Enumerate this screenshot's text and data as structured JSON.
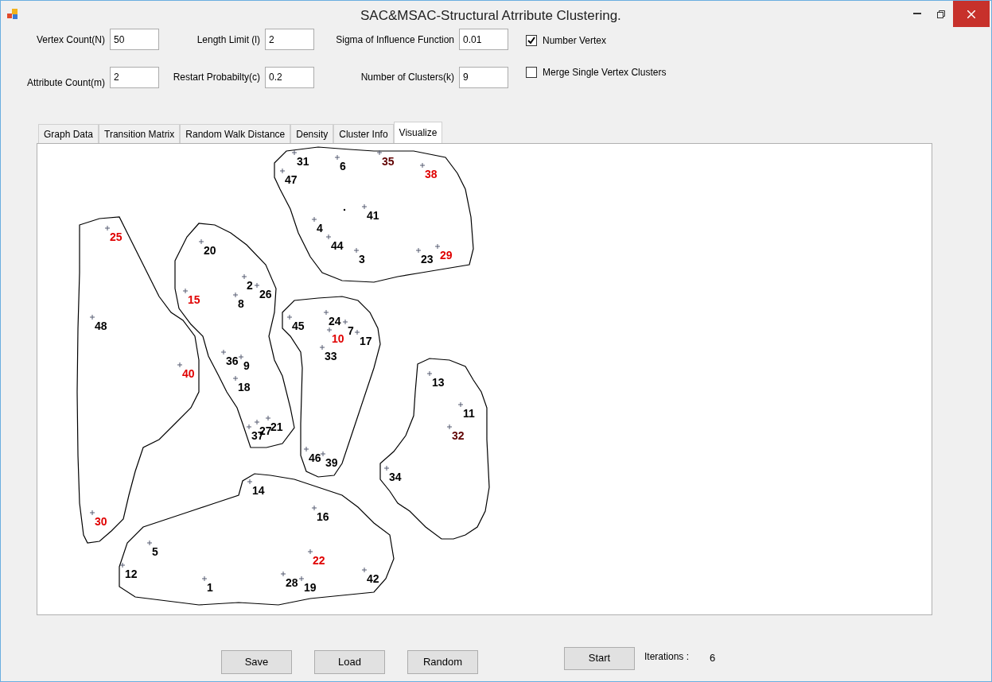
{
  "window": {
    "title": "SAC&MSAC-Structural Atrribute Clustering."
  },
  "field_rows": [
    [
      {
        "label": "Vertex Count(N)",
        "value": "50"
      },
      {
        "label": "Length Limit (l)",
        "value": "2"
      },
      {
        "label": "Sigma of Influence Function",
        "value": "0.01"
      }
    ],
    [
      {
        "label": "Attribute Count(m)",
        "value": "2"
      },
      {
        "label": "Restart Probabilty(c)",
        "value": "0.2"
      },
      {
        "label": "Number of Clusters(k)",
        "value": "9"
      }
    ]
  ],
  "checkboxes": [
    {
      "label": "Number Vertex",
      "checked": true
    },
    {
      "label": "Merge Single Vertex Clusters",
      "checked": false
    }
  ],
  "tabs": [
    {
      "label": "Graph Data",
      "selected": false
    },
    {
      "label": "Transition Matrix",
      "selected": false
    },
    {
      "label": "Random Walk Distance",
      "selected": false
    },
    {
      "label": "Density",
      "selected": false
    },
    {
      "label": "Cluster Info",
      "selected": false
    },
    {
      "label": "Visualize",
      "selected": true
    }
  ],
  "vertices": [
    {
      "label": "31",
      "color": "#000000"
    },
    {
      "label": "35",
      "color": "#600000"
    },
    {
      "label": "6",
      "color": "#000000"
    },
    {
      "label": "38",
      "color": "#e00000"
    },
    {
      "label": "47",
      "color": "#000000"
    },
    {
      "label": "41",
      "color": "#000000"
    },
    {
      "label": "4",
      "color": "#000000"
    },
    {
      "label": "25",
      "color": "#e00000"
    },
    {
      "label": "44",
      "color": "#000000"
    },
    {
      "label": "20",
      "color": "#000000"
    },
    {
      "label": "29",
      "color": "#e00000"
    },
    {
      "label": "3",
      "color": "#000000"
    },
    {
      "label": "23",
      "color": "#000000"
    },
    {
      "label": "2",
      "color": "#000000"
    },
    {
      "label": "26",
      "color": "#000000"
    },
    {
      "label": "15",
      "color": "#e00000"
    },
    {
      "label": "8",
      "color": "#000000"
    },
    {
      "label": "24",
      "color": "#000000"
    },
    {
      "label": "48",
      "color": "#000000"
    },
    {
      "label": "45",
      "color": "#000000"
    },
    {
      "label": "7",
      "color": "#000000"
    },
    {
      "label": "10",
      "color": "#e00000"
    },
    {
      "label": "17",
      "color": "#000000"
    },
    {
      "label": "33",
      "color": "#000000"
    },
    {
      "label": "36",
      "color": "#000000"
    },
    {
      "label": "9",
      "color": "#000000"
    },
    {
      "label": "40",
      "color": "#e00000"
    },
    {
      "label": "13",
      "color": "#000000"
    },
    {
      "label": "18",
      "color": "#000000"
    },
    {
      "label": "11",
      "color": "#000000"
    },
    {
      "label": "21",
      "color": "#000000"
    },
    {
      "label": "27",
      "color": "#000000"
    },
    {
      "label": "37",
      "color": "#000000"
    },
    {
      "label": "32",
      "color": "#600000"
    },
    {
      "label": "46",
      "color": "#000000"
    },
    {
      "label": "39",
      "color": "#000000"
    },
    {
      "label": "34",
      "color": "#000000"
    },
    {
      "label": "14",
      "color": "#000000"
    },
    {
      "label": "16",
      "color": "#000000"
    },
    {
      "label": "30",
      "color": "#e00000"
    },
    {
      "label": "5",
      "color": "#000000"
    },
    {
      "label": "22",
      "color": "#e00000"
    },
    {
      "label": "12",
      "color": "#000000"
    },
    {
      "label": "42",
      "color": "#000000"
    },
    {
      "label": "28",
      "color": "#000000"
    },
    {
      "label": "1",
      "color": "#000000"
    },
    {
      "label": "19",
      "color": "#000000"
    }
  ],
  "buttons": [
    "Save",
    "Load",
    "Random"
  ],
  "start_button": "Start",
  "iterations": {
    "label": "Iterations :",
    "value": "6"
  }
}
